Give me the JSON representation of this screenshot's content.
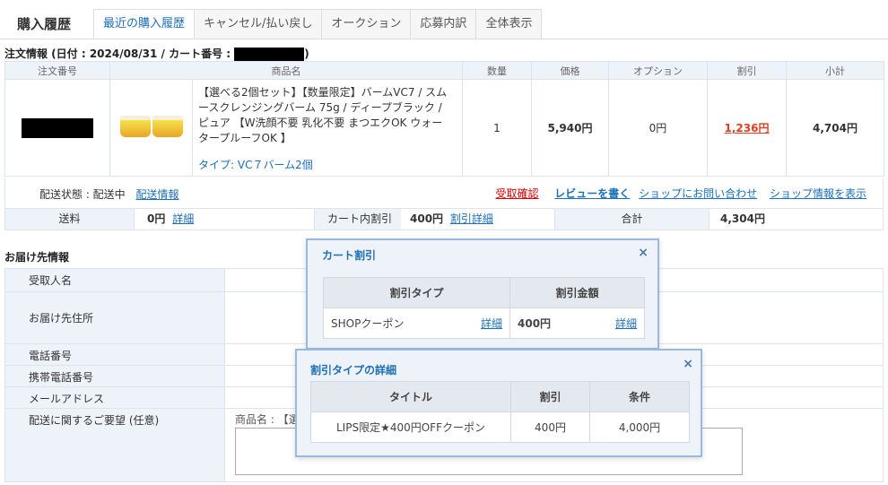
{
  "page_title": "購入履歴",
  "tabs": [
    "最近の購入履歴",
    "キャンセル/払い戻し",
    "オークション",
    "応募内訳",
    "全体表示"
  ],
  "order_heading_prefix": "注文情報 (日付 : 2024/08/31 / カート番号 :",
  "order_heading_suffix": ")",
  "table_headers": [
    "注文番号",
    "商品名",
    "数量",
    "価格",
    "オプション",
    "割引",
    "小計"
  ],
  "product": {
    "name": "【選べる2個セット】【数量限定】バームVC7 / スムースクレンジングバーム 75g / ディープブラック / ピュア 【W洗顔不要 乳化不要 まつエクOK ウォータープルーフOK 】",
    "type": "タイプ: VC７バーム2個",
    "quantity": "1",
    "price": "5,940円",
    "option": "0円",
    "discount": "1,236円",
    "subtotal": "4,704円"
  },
  "status": {
    "label": "配送状態 : 配送中",
    "delivery_info": "配送情報",
    "confirm_receipt": "受取確認",
    "write_review": "レビューを書く",
    "shop_inquiry": "ショップにお問い合わせ",
    "shop_info": "ショップ情報を表示"
  },
  "totals": {
    "shipping_label": "送料",
    "shipping_value": "0円",
    "shipping_detail": "詳細",
    "cart_discount_label": "カート内割引",
    "cart_discount_value": "400円",
    "cart_discount_detail": "割引詳細",
    "total_label": "合計",
    "total_value": "4,304円"
  },
  "delivery": {
    "title": "お届け先情報",
    "rows": [
      "受取人名",
      "お届け先住所",
      "電話番号",
      "携帯電話番号",
      "メールアドレス",
      "配送に関するご要望 (任意)"
    ],
    "request_prefix": "商品名 : 【選"
  },
  "popup_cart": {
    "title": "カート割引",
    "close": "×",
    "headers": [
      "割引タイプ",
      "割引金額"
    ],
    "type": "SHOPクーポン",
    "type_detail": "詳細",
    "amount": "400円",
    "amount_detail": "詳細"
  },
  "popup_detail": {
    "title": "割引タイプの詳細",
    "close": "×",
    "headers": [
      "タイトル",
      "割引",
      "条件"
    ],
    "coupon_title": "LIPS限定★400円OFFクーポン",
    "discount": "400円",
    "condition": "4,000円"
  }
}
